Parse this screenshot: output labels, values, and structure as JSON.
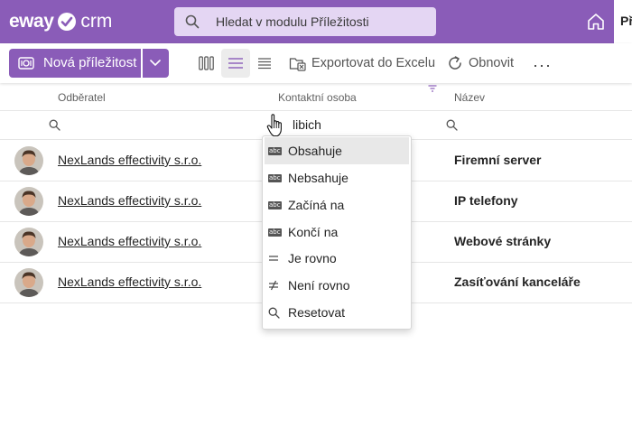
{
  "app": {
    "logo_left": "eway",
    "logo_right": "crm",
    "search_placeholder": "Hledat v modulu Příležitosti",
    "tab_cut_label": "Př"
  },
  "toolbar": {
    "new_label": "Nová příležitost",
    "export_label": "Exportovat do Excelu",
    "refresh_label": "Obnovit",
    "more_label": "···",
    "active_view": "list"
  },
  "columns": {
    "customer": "Odběratel",
    "contact": "Kontaktní osoba",
    "name": "Název"
  },
  "filter": {
    "contact_value": "libich"
  },
  "rows": [
    {
      "customer": "NexLands effectivity s.r.o.",
      "name": "Firemní server"
    },
    {
      "customer": "NexLands effectivity s.r.o.",
      "name": "IP telefony"
    },
    {
      "customer": "NexLands effectivity s.r.o.",
      "name": "Webové stránky"
    },
    {
      "customer": "NexLands effectivity s.r.o.",
      "name": "Zasíťování kanceláře"
    }
  ],
  "filter_menu": {
    "selected": "Obsahuje",
    "items": [
      {
        "label": "Obsahuje",
        "icon": "abc-contains-icon"
      },
      {
        "label": "Nebsahuje",
        "icon": "abc-not-contains-icon"
      },
      {
        "label": "Začíná na",
        "icon": "abc-starts-with-icon"
      },
      {
        "label": "Končí na",
        "icon": "abc-ends-with-icon"
      },
      {
        "label": "Je rovno",
        "icon": "equals-icon"
      },
      {
        "label": "Není rovno",
        "icon": "not-equals-icon"
      },
      {
        "label": "Resetovat",
        "icon": "search-icon"
      }
    ]
  },
  "colors": {
    "brand": "#8a5cb8",
    "search_bg": "#e4d6f3"
  }
}
